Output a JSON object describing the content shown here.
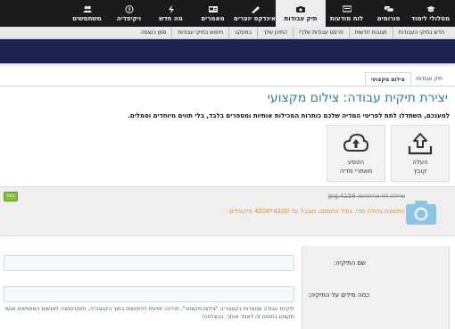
{
  "topnav": [
    {
      "label": "מסלולי לימוד",
      "icon": "graduation-cap-icon",
      "active": false
    },
    {
      "label": "פורומים",
      "icon": "forum-icon",
      "active": false
    },
    {
      "label": "לוח מודעות",
      "icon": "bulletin-board-icon",
      "active": false
    },
    {
      "label": "תיק עבודות",
      "icon": "camera-icon",
      "active": true
    },
    {
      "label": "אינדקס יוצרים",
      "icon": "creators-index-icon",
      "active": false
    },
    {
      "label": "מאמרים",
      "icon": "articles-icon",
      "active": false
    },
    {
      "label": "מה חדש",
      "icon": "whats-new-icon",
      "active": false
    },
    {
      "label": "ויקיפדיה",
      "icon": "wiki-icon",
      "active": false
    },
    {
      "label": "משתמשים",
      "icon": "users-icon",
      "active": false
    }
  ],
  "subnav": [
    "חדש בתיקי העבודות",
    "תגובות חדשות",
    "פרסם עבודות שלך!",
    "התיכן שלך",
    "במעקב",
    "חיפוש בתיקי עבודות",
    "סמן כנצפה"
  ],
  "breadcrumbs": {
    "parent": "תיק עבודות",
    "current": "צילום מקצועי"
  },
  "page_title": "יצירת תיקית עבודה: צילום מקצועי",
  "intro": "למענכם, השתדלו לתת לפריטי המדיה שלכם כותרות המכילות אותיות ומספרים בלבד, בלי תווים מיוחדים וסמלים.",
  "tiles": {
    "upload": {
      "line1": "העלה",
      "line2": "קובץ"
    },
    "web": {
      "line1": "הטמע",
      "line2": "מאתרי מדיה"
    }
  },
  "file": {
    "name": "איילת לוי ארדורוס 4158.jpg",
    "warning": "התמונה גדולה מדי. גודל התמונה מוגבל עד 4200*4200 פיקסלים.",
    "cancel_label": "בטל"
  },
  "form": {
    "name_label": "שם התיקיה:",
    "name_value": "",
    "desc_label": "כמה מילים על התיקיה:",
    "desc_value": "",
    "hint": "תיקיות עבודה שנוצרות בקטגוריה \"צילום מקצועי\", תהיינה זמינות לחיפושים בתוך הקטגוריה, ותפורסמנה לאנשים המחפשים אנשי מקצוע בתחום זה לאתר אותך. בהצלחה!"
  },
  "colors": {
    "nav_bg": "#1b1b1d",
    "banner": "#1c2351",
    "title": "#2a7bb5",
    "warning": "#e0902a",
    "cancel": "#7cc22a"
  }
}
